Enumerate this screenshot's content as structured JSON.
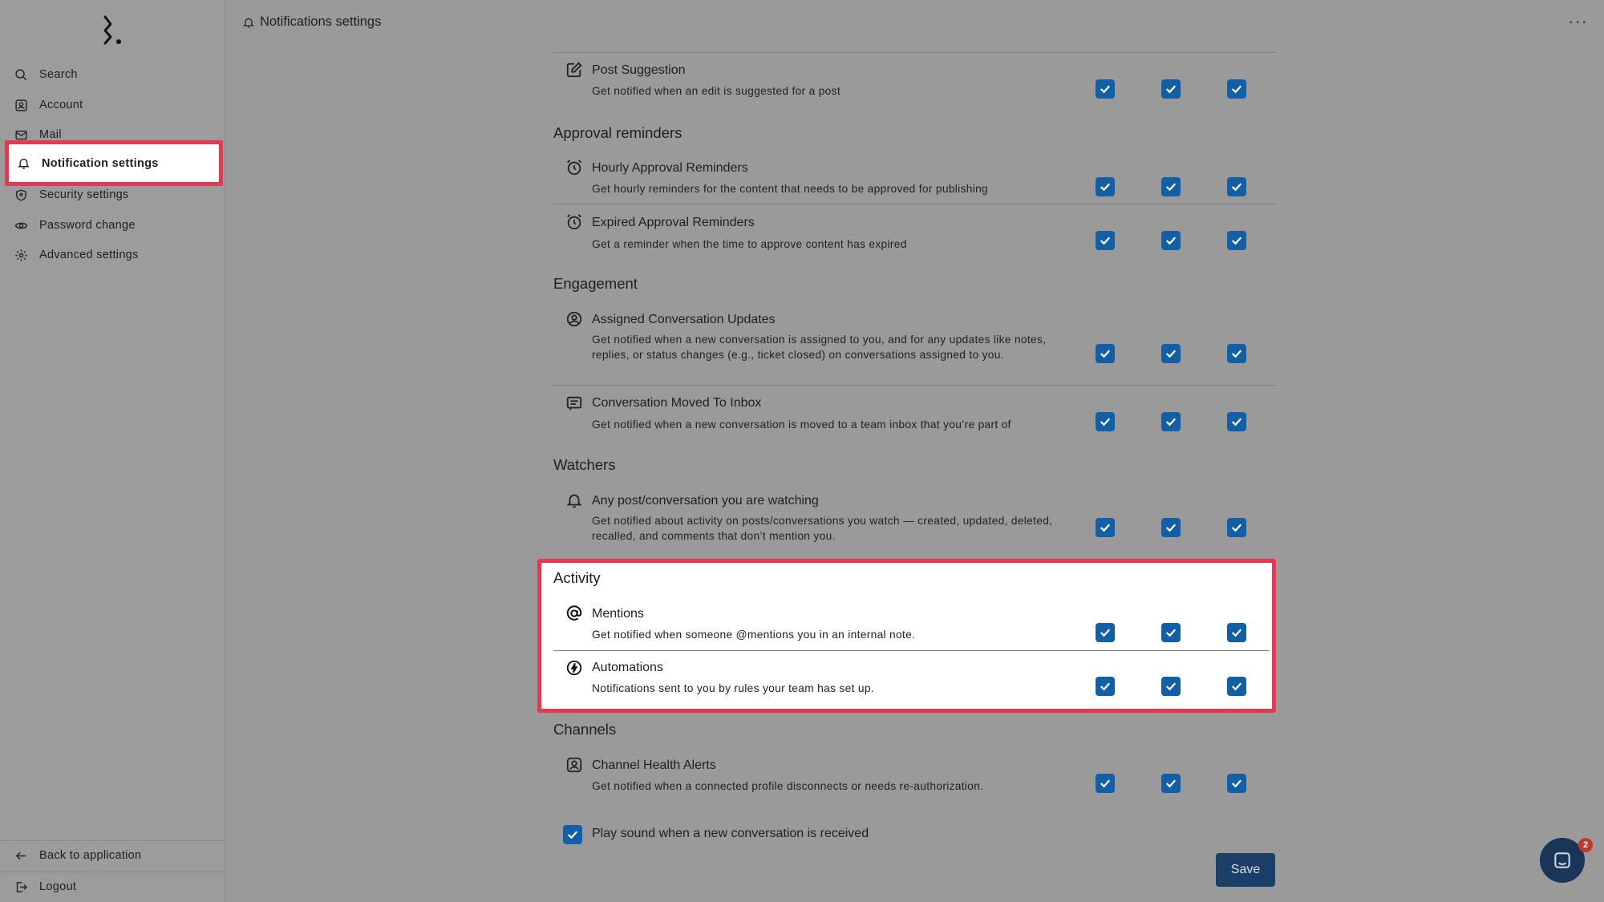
{
  "sidebar": {
    "items": [
      {
        "label": "Search",
        "icon": "search-icon"
      },
      {
        "label": "Account",
        "icon": "account-icon"
      },
      {
        "label": "Mail",
        "icon": "mail-icon"
      },
      {
        "label": "Notification settings",
        "icon": "bell-icon"
      },
      {
        "label": "Security settings",
        "icon": "shield-icon"
      },
      {
        "label": "Password change",
        "icon": "eye-icon"
      },
      {
        "label": "Advanced settings",
        "icon": "gear-icon"
      }
    ],
    "back_label": "Back to application",
    "logout_label": "Logout"
  },
  "header": {
    "title": "Notifications settings"
  },
  "sections": {
    "post": {
      "items": [
        {
          "title": "Post Suggestion",
          "desc": "Get notified when an edit is suggested for a post",
          "icon": "edit-icon"
        }
      ]
    },
    "approval": {
      "title": "Approval reminders",
      "items": [
        {
          "title": "Hourly Approval Reminders",
          "desc": "Get hourly reminders for the content that needs to be approved for publishing",
          "icon": "alarm-clock-icon"
        },
        {
          "title": "Expired Approval Reminders",
          "desc": "Get a reminder when the time to approve content has expired",
          "icon": "alarm-clock-icon"
        }
      ]
    },
    "engagement": {
      "title": "Engagement",
      "items": [
        {
          "title": "Assigned Conversation Updates",
          "desc": "Get notified when a new conversation is assigned to you, and for any updates like notes, replies, or status changes (e.g., ticket closed) on conversations assigned to you.",
          "icon": "user-circle-icon"
        },
        {
          "title": "Conversation Moved To Inbox",
          "desc": "Get notified when a new conversation is moved to a team inbox that you’re part of",
          "icon": "message-icon"
        }
      ]
    },
    "watchers": {
      "title": "Watchers",
      "items": [
        {
          "title": "Any post/conversation you are watching",
          "desc": "Get notified about activity on posts/conversations you watch — created, updated, deleted, recalled, and comments that don’t mention you.",
          "icon": "bell-icon"
        }
      ]
    },
    "activity": {
      "title": "Activity",
      "items": [
        {
          "title": "Mentions",
          "desc": "Get notified when someone @mentions you in an internal note.",
          "icon": "at-icon"
        },
        {
          "title": "Automations",
          "desc": "Notifications sent to you by rules your team has set up.",
          "icon": "bolt-icon"
        }
      ]
    },
    "channels": {
      "title": "Channels",
      "items": [
        {
          "title": "Channel Health Alerts",
          "desc": "Get notified when a connected profile disconnects or needs re-authorization.",
          "icon": "profile-icon"
        }
      ]
    }
  },
  "play_sound_label": "Play sound when a new conversation is received",
  "play_sound_checked": true,
  "save_label": "Save",
  "chat_badge_count": "2",
  "colors": {
    "checkbox": "#115fa6",
    "highlight": "#e8384f",
    "save": "#1c3f6a"
  }
}
